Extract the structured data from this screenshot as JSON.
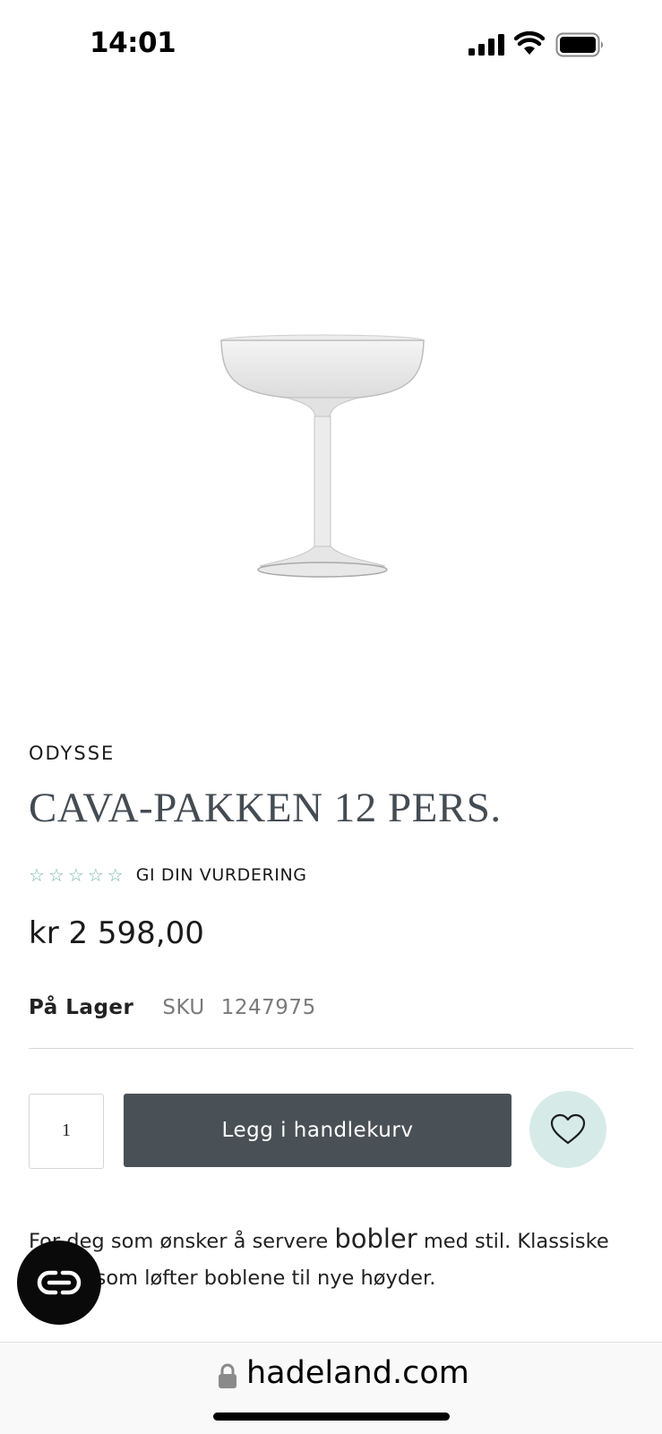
{
  "status_bar": {
    "time": "14:01"
  },
  "product": {
    "brand": "ODYSSE",
    "title": "CAVA-PAKKEN 12 PERS.",
    "rating_stars": 0,
    "rating_max": 5,
    "rate_link": "GI DIN VURDERING",
    "price": "kr 2 598,00",
    "stock": "På Lager",
    "sku_label": "SKU",
    "sku_value": "1247975",
    "quantity": "1",
    "add_to_cart_label": "Legg i handlekurv",
    "description": {
      "part1": "For deg som ønsker å servere ",
      "highlight": "bobler",
      "part2": " med stil. Klassiske skåler som løfter boblene til nye høyder."
    }
  },
  "browser": {
    "url": "hadeland.com"
  },
  "icons": {
    "wishlist": "heart-icon",
    "chat": "chat-icon",
    "lock": "lock-icon"
  },
  "colors": {
    "accent_button": "#4a5156",
    "wishlist_bg": "#d6ebe8",
    "star": "#7ab7ad",
    "title": "#444c53"
  }
}
